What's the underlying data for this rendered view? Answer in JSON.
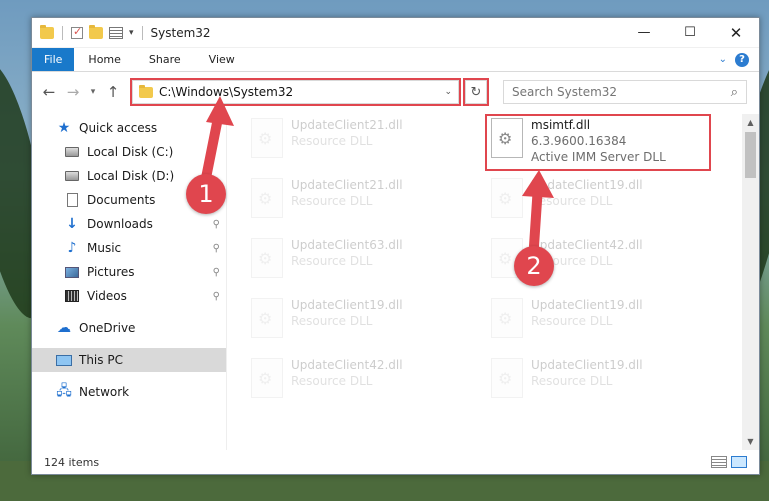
{
  "window": {
    "title": "System32",
    "controls": {
      "minimize": "—",
      "maximize": "☐",
      "close": "✕"
    }
  },
  "ribbon": {
    "tabs": [
      "File",
      "Home",
      "Share",
      "View"
    ],
    "help": "?"
  },
  "nav": {
    "back": "←",
    "forward": "→",
    "recent": "▾",
    "up": "↑",
    "address": "C:\\Windows\\System32",
    "address_dropdown": "⌄",
    "refresh": "↻",
    "search_placeholder": "Search System32",
    "search_icon": "⌕"
  },
  "sidebar": {
    "items": [
      {
        "label": "Quick access",
        "icon": "star-icon"
      },
      {
        "label": "Local Disk (C:)",
        "icon": "disk-icon"
      },
      {
        "label": "Local Disk (D:)",
        "icon": "disk-icon"
      },
      {
        "label": "Documents",
        "icon": "documents-icon"
      },
      {
        "label": "Downloads",
        "icon": "download-icon"
      },
      {
        "label": "Music",
        "icon": "music-icon"
      },
      {
        "label": "Pictures",
        "icon": "pictures-icon"
      },
      {
        "label": "Videos",
        "icon": "videos-icon"
      },
      {
        "label": "OneDrive",
        "icon": "cloud-icon"
      },
      {
        "label": "This PC",
        "icon": "computer-icon"
      },
      {
        "label": "Network",
        "icon": "network-icon"
      }
    ],
    "pin_glyph": "📌"
  },
  "files": {
    "left_column": [
      {
        "name": "UpdateClient21.dll",
        "sub": "Resource DLL"
      },
      {
        "name": "UpdateClient21.dll",
        "sub": "Resource DLL"
      },
      {
        "name": "UpdateClient63.dll",
        "sub": "Resource DLL"
      },
      {
        "name": "UpdateClient19.dll",
        "sub": "Resource DLL"
      },
      {
        "name": "UpdateClient42.dll",
        "sub": "Resource DLL"
      }
    ],
    "right_column": [
      {
        "name": "msimtf.dll",
        "version": "6.3.9600.16384",
        "sub": "Active IMM Server DLL"
      },
      {
        "name": "UpdateClient19.dll",
        "sub": "Resource DLL"
      },
      {
        "name": "UpdateClient42.dll",
        "sub": "Resource DLL"
      },
      {
        "name": "UpdateClient19.dll",
        "sub": "Resource DLL"
      },
      {
        "name": "UpdateClient19.dll",
        "sub": "Resource DLL"
      }
    ]
  },
  "status": {
    "item_count": "124 items"
  },
  "annotations": {
    "badge1": "1",
    "badge2": "2",
    "color": "#e0464e"
  },
  "colors": {
    "accent": "#1979ca",
    "highlight": "#e0464e",
    "selection": "#d9d9d9"
  }
}
